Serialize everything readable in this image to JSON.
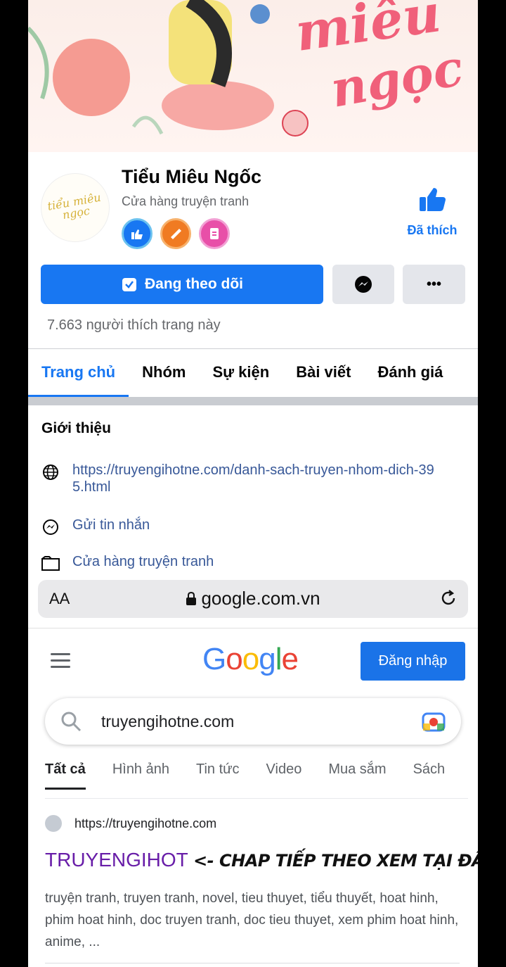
{
  "cover": {
    "script_line1": "miêu",
    "script_line2": "ngọc"
  },
  "profile": {
    "avatar_text": "tiểu miêu ngọc",
    "name": "Tiểu Miêu Ngốc",
    "category": "Cửa hàng truyện tranh",
    "liked_label": "Đã thích"
  },
  "actions": {
    "follow_label": "Đang theo dõi",
    "more_label": "•••"
  },
  "likes_text": "7.663 người thích trang này",
  "tabs": [
    {
      "label": "Trang chủ"
    },
    {
      "label": "Nhóm"
    },
    {
      "label": "Sự kiện"
    },
    {
      "label": "Bài viết"
    },
    {
      "label": "Đánh giá"
    }
  ],
  "intro": {
    "title": "Giới thiệu",
    "website": "https://truyengihotne.com/danh-sach-truyen-nhom-dich-395.html",
    "message": "Gửi tin nhắn",
    "category": "Cửa hàng truyện tranh"
  },
  "browser": {
    "text_size_label": "AA",
    "url": "google.com.vn"
  },
  "google": {
    "logo_letters": [
      "G",
      "o",
      "o",
      "g",
      "l",
      "e"
    ],
    "logo_colors": [
      "#4285f4",
      "#ea4335",
      "#fbbc05",
      "#4285f4",
      "#34a853",
      "#ea4335"
    ],
    "signin_label": "Đăng nhập",
    "query": "truyengihotne.com",
    "tabs": [
      {
        "label": "Tất cả"
      },
      {
        "label": "Hình ảnh"
      },
      {
        "label": "Tin tức"
      },
      {
        "label": "Video"
      },
      {
        "label": "Mua sắm"
      },
      {
        "label": "Sách"
      }
    ],
    "result": {
      "url": "https://truyengihotne.com",
      "title": "TRUYENGIHOT",
      "annotation": "<- CHAP TIẾP THEO XEM TẠI ĐÂY NHA",
      "snippet": "truyện tranh, truyen tranh, novel, tieu thuyet, tiểu thuyết, hoat hinh, phim hoat hinh, doc truyen tranh, doc tieu thuyet, xem phim hoat hinh, anime, ..."
    }
  },
  "colors": {
    "facebook_blue": "#1877f2",
    "google_blue": "#1a73e8",
    "visited_link": "#681da8"
  }
}
